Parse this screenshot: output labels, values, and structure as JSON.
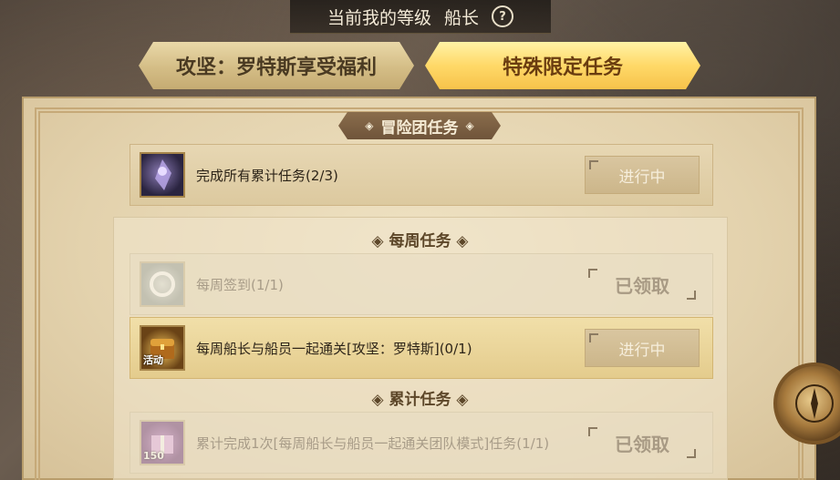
{
  "header": {
    "label": "当前我的等级",
    "rank": "船长",
    "help_glyph": "?"
  },
  "tabs": [
    {
      "label": "攻坚：罗特斯享受福利",
      "active": false
    },
    {
      "label": "特殊限定任务",
      "active": true
    }
  ],
  "section": {
    "title": "冒险团任务",
    "diamond_left": "◈",
    "diamond_right": "◈"
  },
  "main_task": {
    "text": "完成所有累计任务(2/3)",
    "status": "进行中",
    "icon": "crystal-warrior-icon"
  },
  "weekly": {
    "title": "◈ 每周任务 ◈",
    "tasks": [
      {
        "text": "每周签到(1/1)",
        "status": "已领取",
        "icon": "ring-icon",
        "state": "claimed"
      },
      {
        "text": "每周船长与船员一起通关[攻坚：罗特斯](0/1)",
        "status": "进行中",
        "icon": "treasure-chest-icon",
        "badge": "活动",
        "state": "in-progress"
      }
    ]
  },
  "cumulative": {
    "title": "◈ 累计任务 ◈",
    "tasks": [
      {
        "text": "累计完成1次[每周船长与船员一起通关团队模式]任务(1/1)",
        "status": "已领取",
        "icon": "gift-box-icon",
        "badge": "150",
        "state": "claimed"
      }
    ]
  },
  "compass_icon": "compass-icon",
  "colors": {
    "active_tab": "#ffd968",
    "inactive_tab": "#d4bd86",
    "parchment": "#e3d2ad",
    "section_title_bg": "#7d6043"
  }
}
